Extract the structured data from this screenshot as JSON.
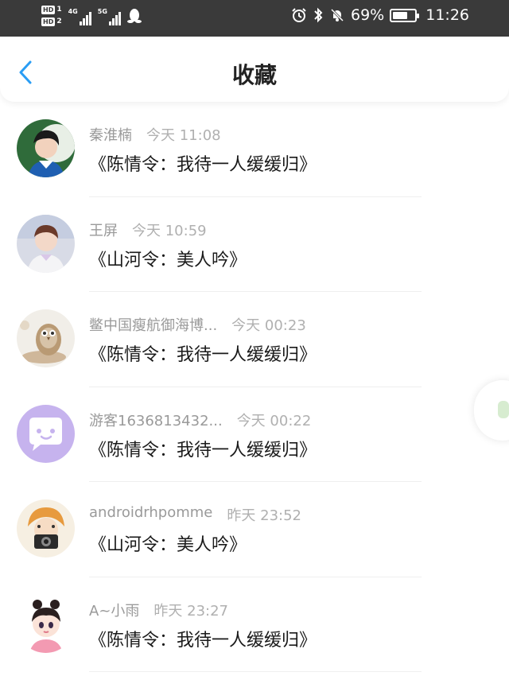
{
  "status_bar": {
    "hd1": "HD",
    "sim1": "1",
    "hd2": "HD",
    "sim2": "2",
    "net1": "4G",
    "net2": "5G",
    "battery": "69%",
    "battery_level": 0.69,
    "time": "11:26",
    "icons": [
      "qq-penguin-icon",
      "alarm-icon",
      "bluetooth-icon",
      "mute-bell-icon",
      "battery-icon"
    ]
  },
  "header": {
    "title": "收藏",
    "back_icon": "chevron-left-icon",
    "accent_color": "#2a9df4"
  },
  "favorites": [
    {
      "user": "秦淮楠",
      "time": "今天 11:08",
      "title": "《陈情令：我待一人缓缓归》"
    },
    {
      "user": "王屏",
      "time": "今天 10:59",
      "title": "《山河令：美人吟》"
    },
    {
      "user": "鳖中国瘦航御海博...",
      "time": "今天 00:23",
      "title": "《陈情令：我待一人缓缓归》"
    },
    {
      "user": "游客1636813432...",
      "time": "今天 00:22",
      "title": "《陈情令：我待一人缓缓归》"
    },
    {
      "user": "androidrhpomme",
      "time": "昨天 23:52",
      "title": "《山河令：美人吟》"
    },
    {
      "user": "A~小雨",
      "time": "昨天 23:27",
      "title": "《陈情令：我待一人缓缓归》"
    }
  ]
}
